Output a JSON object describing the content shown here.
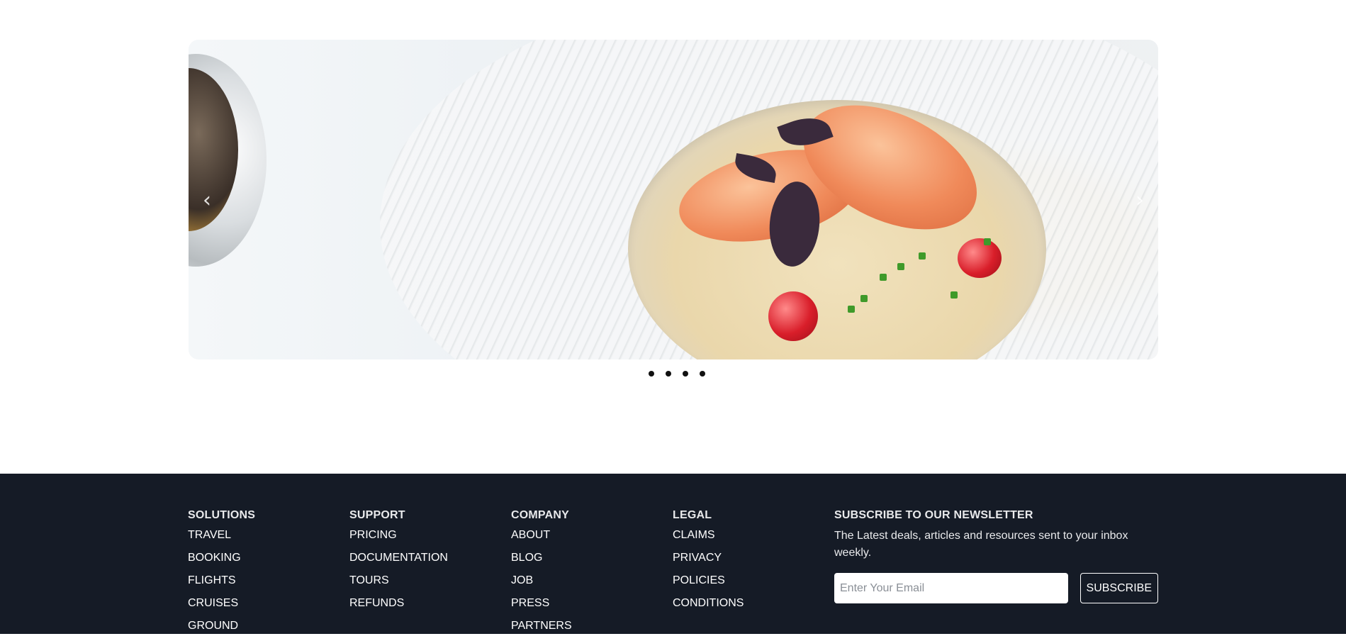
{
  "carousel": {
    "prev_icon": "‹",
    "next_icon": "›",
    "slide_count": 4,
    "active_slide": 1,
    "image_alt": "seafood-dish-photo"
  },
  "footer": {
    "columns": [
      {
        "heading": "SOLUTIONS",
        "items": [
          "TRAVEL",
          "BOOKING",
          "FLIGHTS",
          "CRUISES",
          "GROUND"
        ]
      },
      {
        "heading": "SUPPORT",
        "items": [
          "PRICING",
          "DOCUMENTATION",
          "TOURS",
          "REFUNDS"
        ]
      },
      {
        "heading": "COMPANY",
        "items": [
          "ABOUT",
          "BLOG",
          "JOB",
          "PRESS",
          "PARTNERS"
        ]
      },
      {
        "heading": "LEGAL",
        "items": [
          "CLAIMS",
          "PRIVACY",
          "POLICIES",
          "CONDITIONS"
        ]
      }
    ],
    "newsletter": {
      "heading": "SUBSCRIBE TO OUR NEWSLETTER",
      "description": "The Latest deals, articles and resources sent to your inbox weekly.",
      "email_placeholder": "Enter Your Email",
      "button_label": "SUBSCRIBE"
    }
  },
  "colors": {
    "footer_bg": "#151b26",
    "dot": "#111111"
  }
}
